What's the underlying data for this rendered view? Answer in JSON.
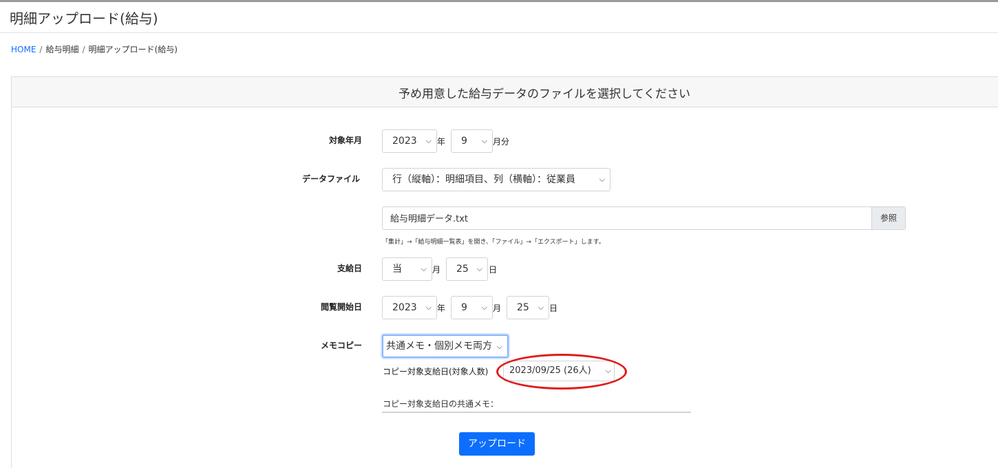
{
  "page": {
    "title": "明細アップロード(給与)"
  },
  "breadcrumb": {
    "home": "HOME",
    "sep": "/",
    "level1": "給与明細",
    "level2": "明細アップロード(給与)"
  },
  "card": {
    "header": "予め用意した給与データのファイルを選択してください"
  },
  "form": {
    "target_month": {
      "label": "対象年月",
      "year": "2023",
      "year_unit": "年",
      "month": "9",
      "month_unit": "月分"
    },
    "data_file": {
      "label": "データファイル",
      "layout": "行（縦軸）：明細項目、列（横軸）：従業員",
      "file_name": "給与明細データ.txt",
      "browse_label": "参照",
      "hint": "「集計」→「給与明細一覧表」を開き、「ファイル」→「エクスポート」します。"
    },
    "pay_day": {
      "label": "支給日",
      "month": "当",
      "month_unit": "月",
      "day": "25",
      "day_unit": "日"
    },
    "view_start": {
      "label": "閲覧開始日",
      "year": "2023",
      "year_unit": "年",
      "month": "9",
      "month_unit": "月",
      "day": "25",
      "day_unit": "日"
    },
    "memo_copy": {
      "label": "メモコピー",
      "option": "共通メモ・個別メモ両方",
      "copy_date_label": "コピー対象支給日(対象人数)",
      "copy_date": "2023/09/25 (26人)",
      "common_memo_label": "コピー対象支給日の共通メモ："
    },
    "upload_label": "アップロード"
  },
  "colors": {
    "primary": "#0d6efd",
    "annotation": "#e01b1b"
  },
  "icons": {
    "select_arrow": "chevron-down-icon"
  }
}
